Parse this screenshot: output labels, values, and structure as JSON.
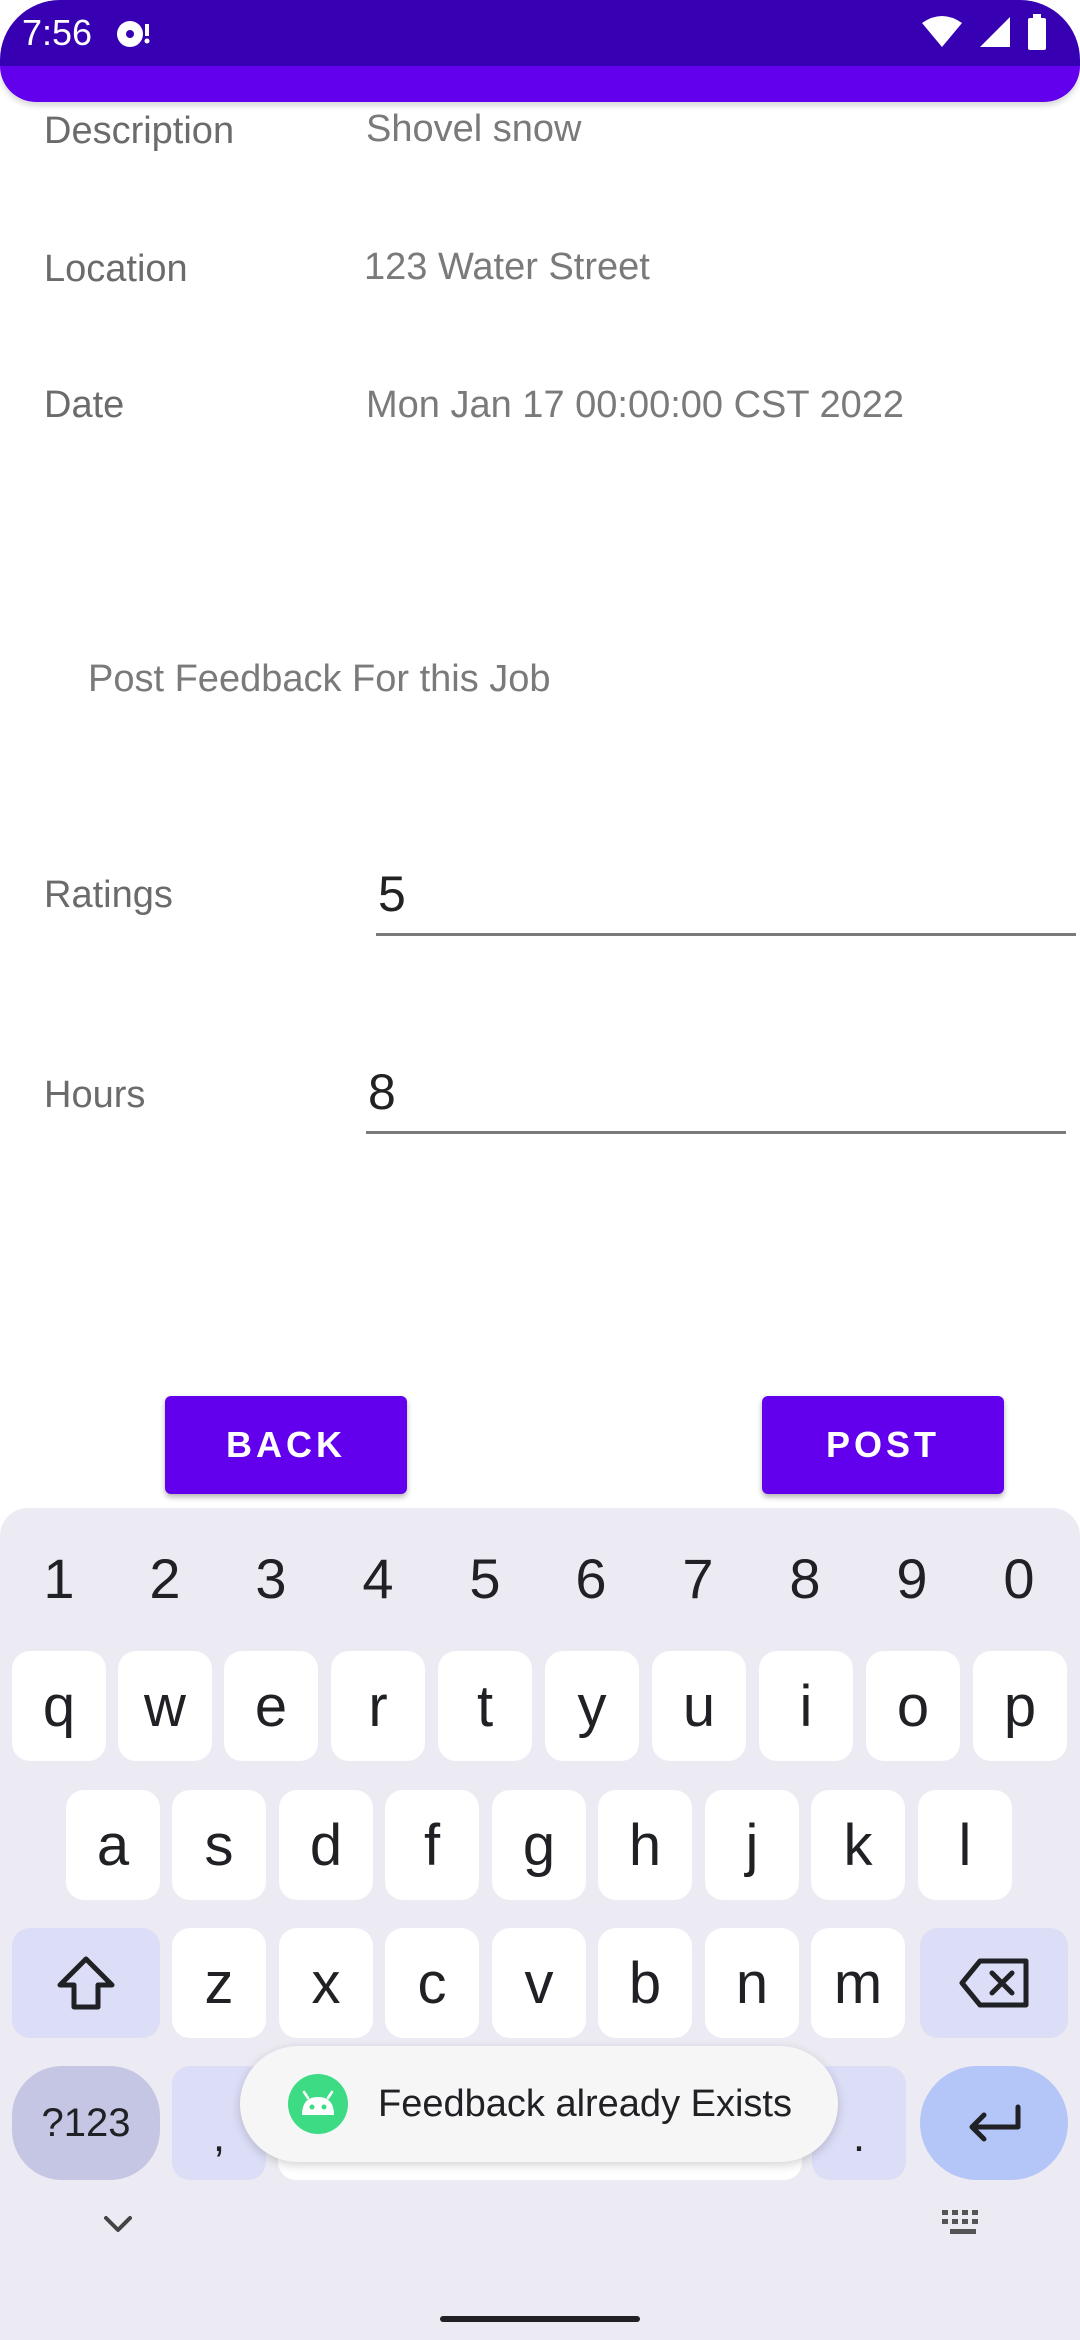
{
  "status_bar": {
    "time": "7:56"
  },
  "details": {
    "description_label": "Description",
    "description_value": "Shovel snow",
    "location_label": "Location",
    "location_value": "123 Water Street",
    "date_label": "Date",
    "date_value": "Mon Jan 17 00:00:00 CST 2022"
  },
  "feedback": {
    "title": "Post Feedback For this Job",
    "ratings_label": "Ratings",
    "ratings_value": "5",
    "hours_label": "Hours",
    "hours_value": "8"
  },
  "buttons": {
    "back": "BACK",
    "post": "POST"
  },
  "keyboard": {
    "numbers": [
      "1",
      "2",
      "3",
      "4",
      "5",
      "6",
      "7",
      "8",
      "9",
      "0"
    ],
    "row1": [
      "q",
      "w",
      "e",
      "r",
      "t",
      "y",
      "u",
      "i",
      "o",
      "p"
    ],
    "row2": [
      "a",
      "s",
      "d",
      "f",
      "g",
      "h",
      "j",
      "k",
      "l"
    ],
    "row3": [
      "z",
      "x",
      "c",
      "v",
      "b",
      "n",
      "m"
    ],
    "symbols_key": "?123",
    "comma_key": ",",
    "period_key": "."
  },
  "toast": {
    "message": "Feedback already Exists"
  },
  "colors": {
    "primary": "#6200EE",
    "primary_dark": "#3700B3"
  }
}
